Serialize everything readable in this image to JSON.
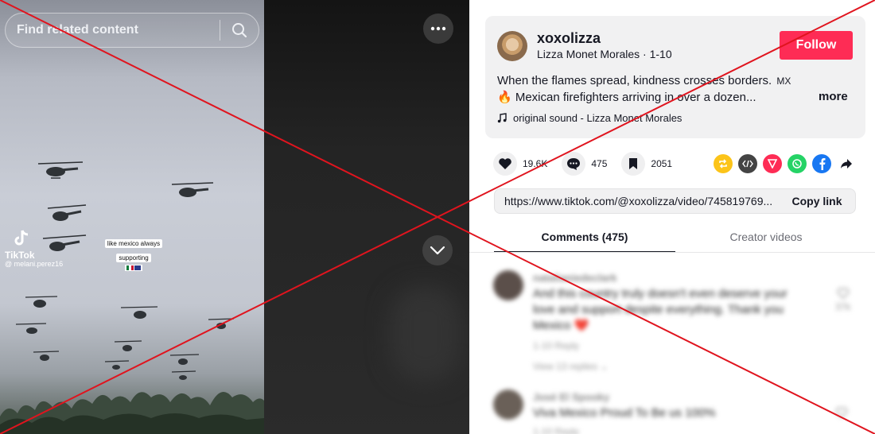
{
  "search": {
    "placeholder": "Find related content"
  },
  "video": {
    "tiktok_word": "TikTok",
    "tiktok_user": "@ melani.perez16",
    "sticker_line1": "like mexico always",
    "sticker_line2": "supporting"
  },
  "profile": {
    "username": "xoxolizza",
    "display_name_date": "Lizza Monet Morales · 1-10",
    "follow_label": "Follow",
    "description_line1": "When the flames spread, kindness crosses borders.",
    "description_line1_suffix": "MX",
    "description_line2": "🔥 Mexican firefighters arriving in over a dozen...",
    "more_label": "more",
    "music": "original sound - Lizza Monet Morales"
  },
  "actions": {
    "likes": "19.6K",
    "comments": "475",
    "saves": "2051"
  },
  "share_icons": [
    "repost-icon",
    "embed-icon",
    "send-icon",
    "whatsapp-icon",
    "facebook-icon",
    "share-arrow-icon"
  ],
  "link": {
    "url": "https://www.tiktok.com/@xoxolizza/video/745819769...",
    "copy_label": "Copy link"
  },
  "tabs": {
    "comments": "Comments (475)",
    "creator": "Creator videos"
  },
  "comments_list": [
    {
      "user": "natalianiedeclark",
      "text": "And this country truly doesn't even deserve your love and support despite everything. Thank you Mexico ❤️",
      "meta": "1-10     Reply",
      "replies": "View 13 replies ⌄",
      "likes": "37k"
    },
    {
      "user": "José El Spooky",
      "text": "Viva Mexico Proud To Be us 100%",
      "meta": "1-10     Reply",
      "likes": ""
    }
  ],
  "colors": {
    "accent": "#fe2c55",
    "overlay_x": "#e0141e"
  }
}
